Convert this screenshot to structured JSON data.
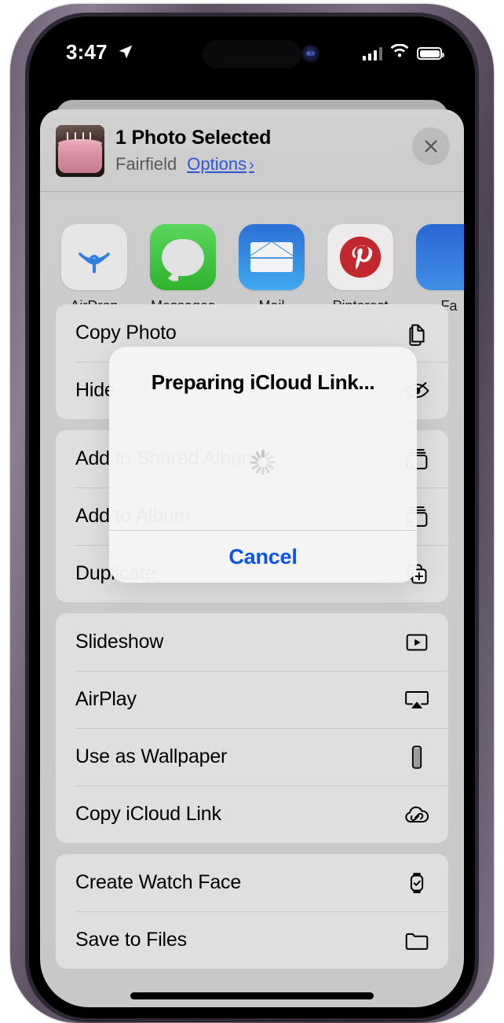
{
  "status_bar": {
    "time": "3:47",
    "location_icon": "location-arrow-icon",
    "cellular_icon": "cellular-bars-icon",
    "cellular_bars_filled": 3,
    "wifi_icon": "wifi-icon",
    "battery_icon": "battery-icon"
  },
  "share_sheet": {
    "header": {
      "thumbnail_alt": "photo-thumbnail",
      "title": "1 Photo Selected",
      "subtitle": "Fairfield",
      "options_label": "Options",
      "options_chevron": "›",
      "close_icon": "close-icon"
    },
    "apps": [
      {
        "name": "AirDrop",
        "icon": "airdrop-icon"
      },
      {
        "name": "Messages",
        "icon": "messages-icon"
      },
      {
        "name": "Mail",
        "icon": "mail-icon"
      },
      {
        "name": "Pinterest",
        "icon": "pinterest-icon"
      },
      {
        "name": "Fa",
        "icon": "facebook-icon"
      }
    ],
    "groups": [
      {
        "rows": [
          {
            "label": "Copy Photo",
            "icon": "copy-icon"
          },
          {
            "label": "Hide",
            "icon": "eye-slash-icon"
          }
        ]
      },
      {
        "rows": [
          {
            "label": "Add to Shared Album",
            "icon": "shared-album-icon"
          },
          {
            "label": "Add to Album",
            "icon": "add-album-icon"
          },
          {
            "label": "Duplicate",
            "icon": "duplicate-icon"
          }
        ]
      },
      {
        "rows": [
          {
            "label": "Slideshow",
            "icon": "slideshow-icon"
          },
          {
            "label": "AirPlay",
            "icon": "airplay-icon"
          },
          {
            "label": "Use as Wallpaper",
            "icon": "wallpaper-icon"
          },
          {
            "label": "Copy iCloud Link",
            "icon": "icloud-link-icon"
          }
        ]
      },
      {
        "rows": [
          {
            "label": "Create Watch Face",
            "icon": "watch-icon"
          },
          {
            "label": "Save to Files",
            "icon": "folder-icon"
          }
        ]
      }
    ]
  },
  "alert": {
    "title": "Preparing iCloud Link...",
    "spinner_icon": "activity-spinner-icon",
    "cancel_label": "Cancel"
  },
  "colors": {
    "link_blue": "#2f56d8",
    "action_blue": "#0b53f0",
    "sheet_bg": "#cecdcd",
    "row_bg": "#e0dfdf"
  }
}
